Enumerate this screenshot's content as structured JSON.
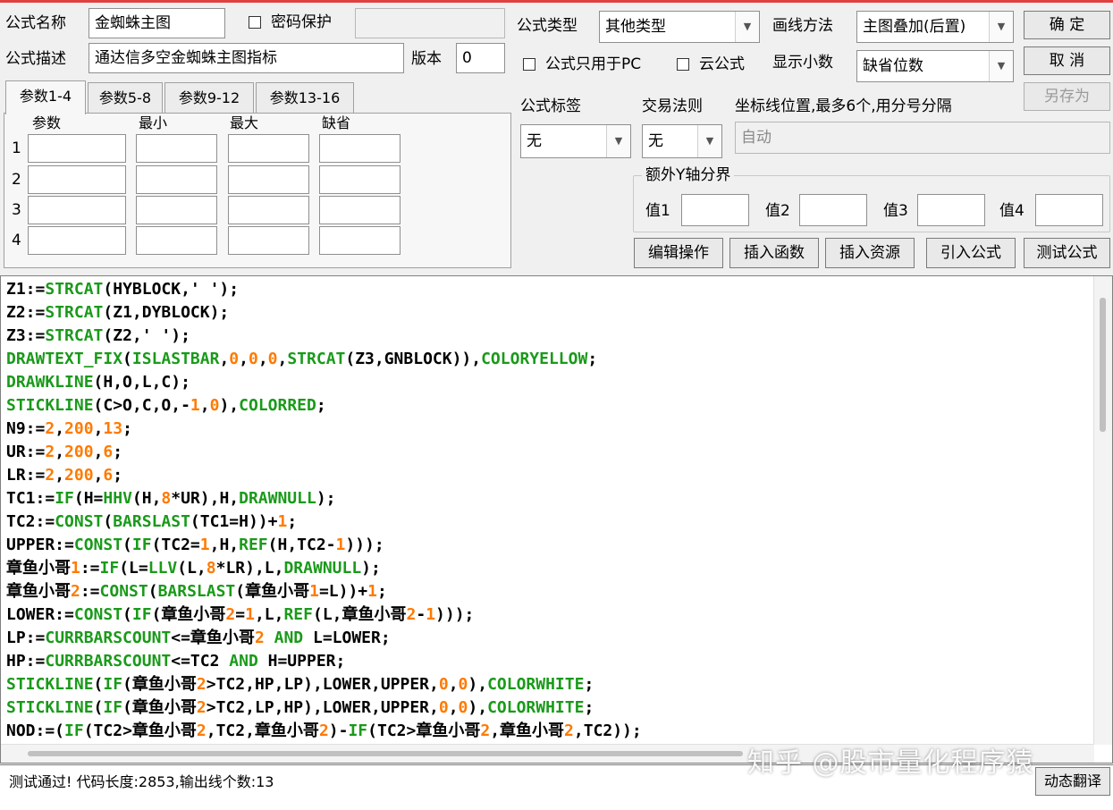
{
  "header": {
    "name_label": "公式名称",
    "name_value": "金蜘蛛主图",
    "password_label": "密码保护",
    "password_value": "",
    "desc_label": "公式描述",
    "desc_value": "通达信多空金蜘蛛主图指标",
    "version_label": "版本",
    "version_value": "0",
    "type_label": "公式类型",
    "type_value": "其他类型",
    "draw_label": "画线方法",
    "draw_value": "主图叠加(后置)",
    "pc_only_label": "公式只用于PC",
    "cloud_label": "云公式",
    "decimals_label": "显示小数",
    "decimals_value": "缺省位数"
  },
  "buttons": {
    "ok": "确  定",
    "cancel": "取  消",
    "save_as": "另存为",
    "edit_ops": "编辑操作",
    "insert_func": "插入函数",
    "insert_res": "插入资源",
    "import_formula": "引入公式",
    "test_formula": "测试公式",
    "dynamic_translate": "动态翻译"
  },
  "tabs": [
    "参数1-4",
    "参数5-8",
    "参数9-12",
    "参数13-16"
  ],
  "params": {
    "headers": [
      "参数",
      "最小",
      "最大",
      "缺省"
    ],
    "rows": [
      "1",
      "2",
      "3",
      "4"
    ]
  },
  "settings": {
    "tag_label": "公式标签",
    "tag_value": "无",
    "rule_label": "交易法则",
    "rule_value": "无",
    "axis_label": "坐标线位置,最多6个,用分号分隔",
    "axis_value": "自动",
    "yaxis_group": "额外Y轴分界",
    "v1": "值1",
    "v2": "值2",
    "v3": "值3",
    "v4": "值4"
  },
  "code_lines": [
    "Z1:=STRCAT(HYBLOCK,' ');",
    "Z2:=STRCAT(Z1,DYBLOCK);",
    "Z3:=STRCAT(Z2,' ');",
    "DRAWTEXT_FIX(ISLASTBAR,0,0,0,STRCAT(Z3,GNBLOCK)),COLORYELLOW;",
    "DRAWKLINE(H,O,L,C);",
    "STICKLINE(C>O,C,O,-1,0),COLORRED;",
    "N9:=2,200,13;",
    "UR:=2,200,6;",
    "LR:=2,200,6;",
    "TC1:=IF(H=HHV(H,8*UR),H,DRAWNULL);",
    "TC2:=CONST(BARSLAST(TC1=H))+1;",
    "UPPER:=CONST(IF(TC2=1,H,REF(H,TC2-1)));",
    "章鱼小哥1:=IF(L=LLV(L,8*LR),L,DRAWNULL);",
    "章鱼小哥2:=CONST(BARSLAST(章鱼小哥1=L))+1;",
    "LOWER:=CONST(IF(章鱼小哥2=1,L,REF(L,章鱼小哥2-1)));",
    "LP:=CURRBARSCOUNT<=章鱼小哥2 AND L=LOWER;",
    "HP:=CURRBARSCOUNT<=TC2 AND H=UPPER;",
    "STICKLINE(IF(章鱼小哥2>TC2,HP,LP),LOWER,UPPER,0,0),COLORWHITE;",
    "STICKLINE(IF(章鱼小哥2>TC2,LP,HP),LOWER,UPPER,0,0),COLORWHITE;",
    "NOD:=(IF(TC2>章鱼小哥2,TC2,章鱼小哥2)-IF(TC2>章鱼小哥2,章鱼小哥2,TC2));"
  ],
  "status": {
    "message": "测试通过! 代码长度:2853,输出线个数:13"
  },
  "watermark": "知乎 @股市量化程序猿",
  "colors": {
    "function_green": "#1a9a1a",
    "number_orange": "#ff7a00",
    "title_bar_red": "#e04040"
  }
}
